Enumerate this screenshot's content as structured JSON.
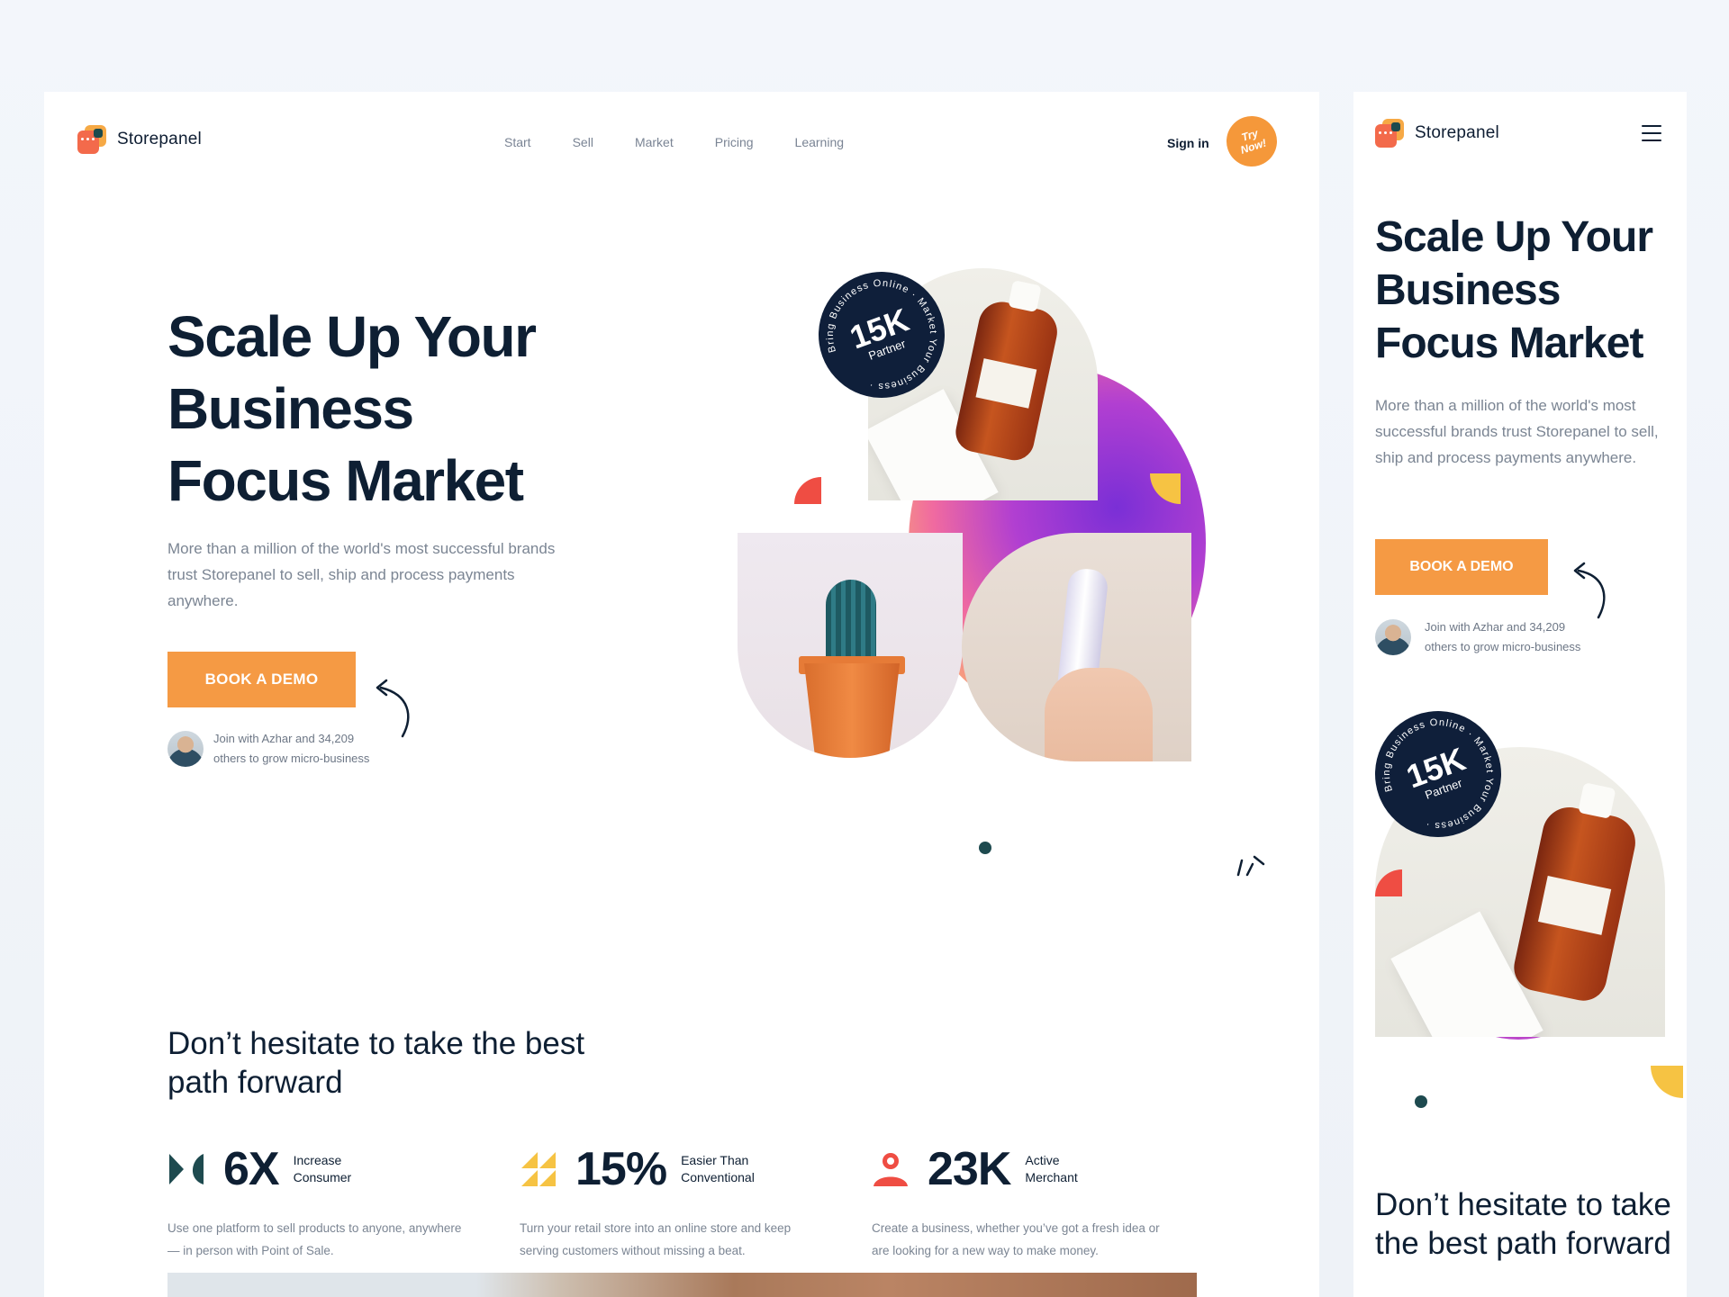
{
  "brand": {
    "name": "Storepanel"
  },
  "nav": {
    "items": [
      "Start",
      "Sell",
      "Market",
      "Pricing",
      "Learning"
    ],
    "sign_in": "Sign in",
    "try_now_line1": "Try",
    "try_now_line2": "Now!"
  },
  "hero": {
    "title_line1": "Scale Up Your",
    "title_line2": "Business",
    "title_line3": "Focus Market",
    "lead": "More than a million of the world's most successful brands trust Storepanel to sell, ship and process payments anywhere.",
    "cta": "BOOK A DEMO",
    "join_line1": "Join with Azhar and 34,209",
    "join_line2": "others to grow micro-business"
  },
  "badge": {
    "value": "15K",
    "label": "Partner",
    "ring_text": "Bring Business Online · Market Your Business ·"
  },
  "section": {
    "title": "Don’t hesitate to take the best path forward"
  },
  "stats": [
    {
      "icon": "bowtie-icon",
      "value": "6X",
      "label": "Increase Consumer",
      "desc": "Use one platform to sell products to anyone, anywhere — in person with Point of Sale.",
      "color": "#1e4a4f"
    },
    {
      "icon": "stairs-icon",
      "value": "15%",
      "label": "Easier Than Conventional",
      "desc": "Turn your retail store into an online store and keep serving customers without missing a beat.",
      "color": "#f6c343"
    },
    {
      "icon": "user-icon",
      "value": "23K",
      "label": "Active Merchant",
      "desc": "Create a business, whether you’ve got a fresh idea or are looking for a new way to make money.",
      "color": "#ef4d43"
    }
  ],
  "mobile": {
    "brand": "Storepanel",
    "title_line1": "Scale Up Your",
    "title_line2": "Business",
    "title_line3": "Focus Market",
    "lead": "More than a million of the world's most successful brands trust Storepanel to sell, ship and process payments anywhere.",
    "cta": "BOOK A DEMO",
    "join_line1": "Join with Azhar and 34,209",
    "join_line2": "others to grow micro-business",
    "section_title": "Don’t hesitate to take the best path forward"
  },
  "colors": {
    "accent": "#f59a44",
    "navy": "#0e1f33",
    "muted": "#7b8593",
    "teal": "#1e4a4f"
  }
}
